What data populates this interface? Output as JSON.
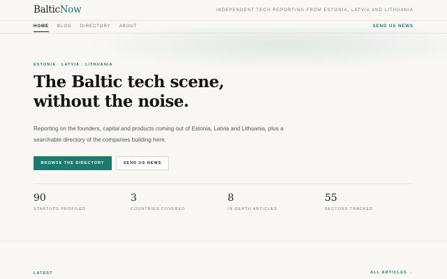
{
  "header": {
    "logo_main": "Baltic",
    "logo_accent": "Now",
    "tagline": "Independent tech reporting from Estonia, Latvia and Lithuania"
  },
  "nav": {
    "items": [
      {
        "label": "Home",
        "active": true
      },
      {
        "label": "Blog",
        "active": false
      },
      {
        "label": "Directory",
        "active": false
      },
      {
        "label": "About",
        "active": false
      }
    ],
    "cta_label": "Send us news"
  },
  "hero": {
    "eyebrow": "Estonia · Latvia · Lithuania",
    "headline_line1": "The Baltic tech scene,",
    "headline_line2": "without the noise.",
    "lede": "Reporting on the founders, capital and products coming out of Estonia, Latvia and Lithuania, plus a searchable directory of the companies building here.",
    "primary_button": "Browse the directory",
    "secondary_button": "Send us news"
  },
  "stats": [
    {
      "value": "90",
      "label": "Startups profiled"
    },
    {
      "value": "3",
      "label": "Countries covered"
    },
    {
      "value": "8",
      "label": "In-depth articles"
    },
    {
      "value": "55",
      "label": "Sectors tracked"
    }
  ],
  "latest": {
    "label": "Latest",
    "link_label": "All articles →"
  },
  "colors": {
    "accent": "#1d7a6e",
    "background": "#f8f7f4",
    "text": "#1c1c1a"
  }
}
